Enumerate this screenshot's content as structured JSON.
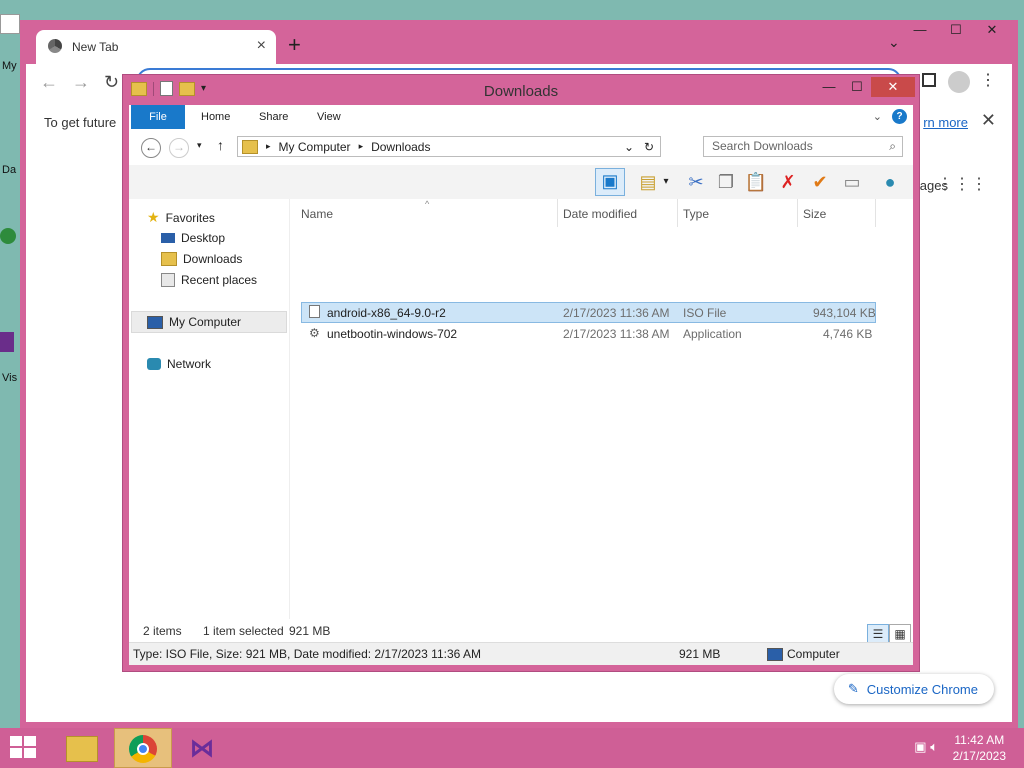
{
  "desktop": {
    "labels": [
      "My",
      "Da",
      "Vis"
    ]
  },
  "chrome": {
    "tab_title": "New Tab",
    "info_text": "To get future",
    "info_link": "rn more",
    "apps_label": "ages",
    "customize_label": "Customize Chrome",
    "window_min": "—",
    "window_max": "☐",
    "window_close": "✕"
  },
  "explorer": {
    "title": "Downloads",
    "ribbon_tabs": [
      "File",
      "Home",
      "Share",
      "View"
    ],
    "help": "?",
    "address": {
      "segments": [
        "My Computer",
        "Downloads"
      ]
    },
    "search_placeholder": "Search Downloads",
    "nav": {
      "favorites": "Favorites",
      "desktop": "Desktop",
      "downloads": "Downloads",
      "recent": "Recent places",
      "computer": "My Computer",
      "network": "Network"
    },
    "columns": [
      "Name",
      "Date modified",
      "Type",
      "Size"
    ],
    "files": [
      {
        "name": "android-x86_64-9.0-r2",
        "date": "2/17/2023 11:36 AM",
        "type": "ISO File",
        "size": "943,104 KB",
        "selected": true
      },
      {
        "name": "unetbootin-windows-702",
        "date": "2/17/2023 11:38 AM",
        "type": "Application",
        "size": "4,746 KB",
        "selected": false
      }
    ],
    "status": {
      "items": "2 items",
      "selected": "1 item selected",
      "size": "921 MB"
    },
    "details": {
      "summary": "Type: ISO File, Size: 921 MB, Date modified: 2/17/2023 11:36 AM",
      "size": "921 MB",
      "location": "Computer"
    }
  },
  "taskbar": {
    "time": "11:42 AM",
    "date": "2/17/2023"
  },
  "colors": {
    "window_frame": "#d4649a",
    "taskbar": "#cf5f96",
    "accent_blue": "#1979ca",
    "selection": "#cce4f7"
  }
}
